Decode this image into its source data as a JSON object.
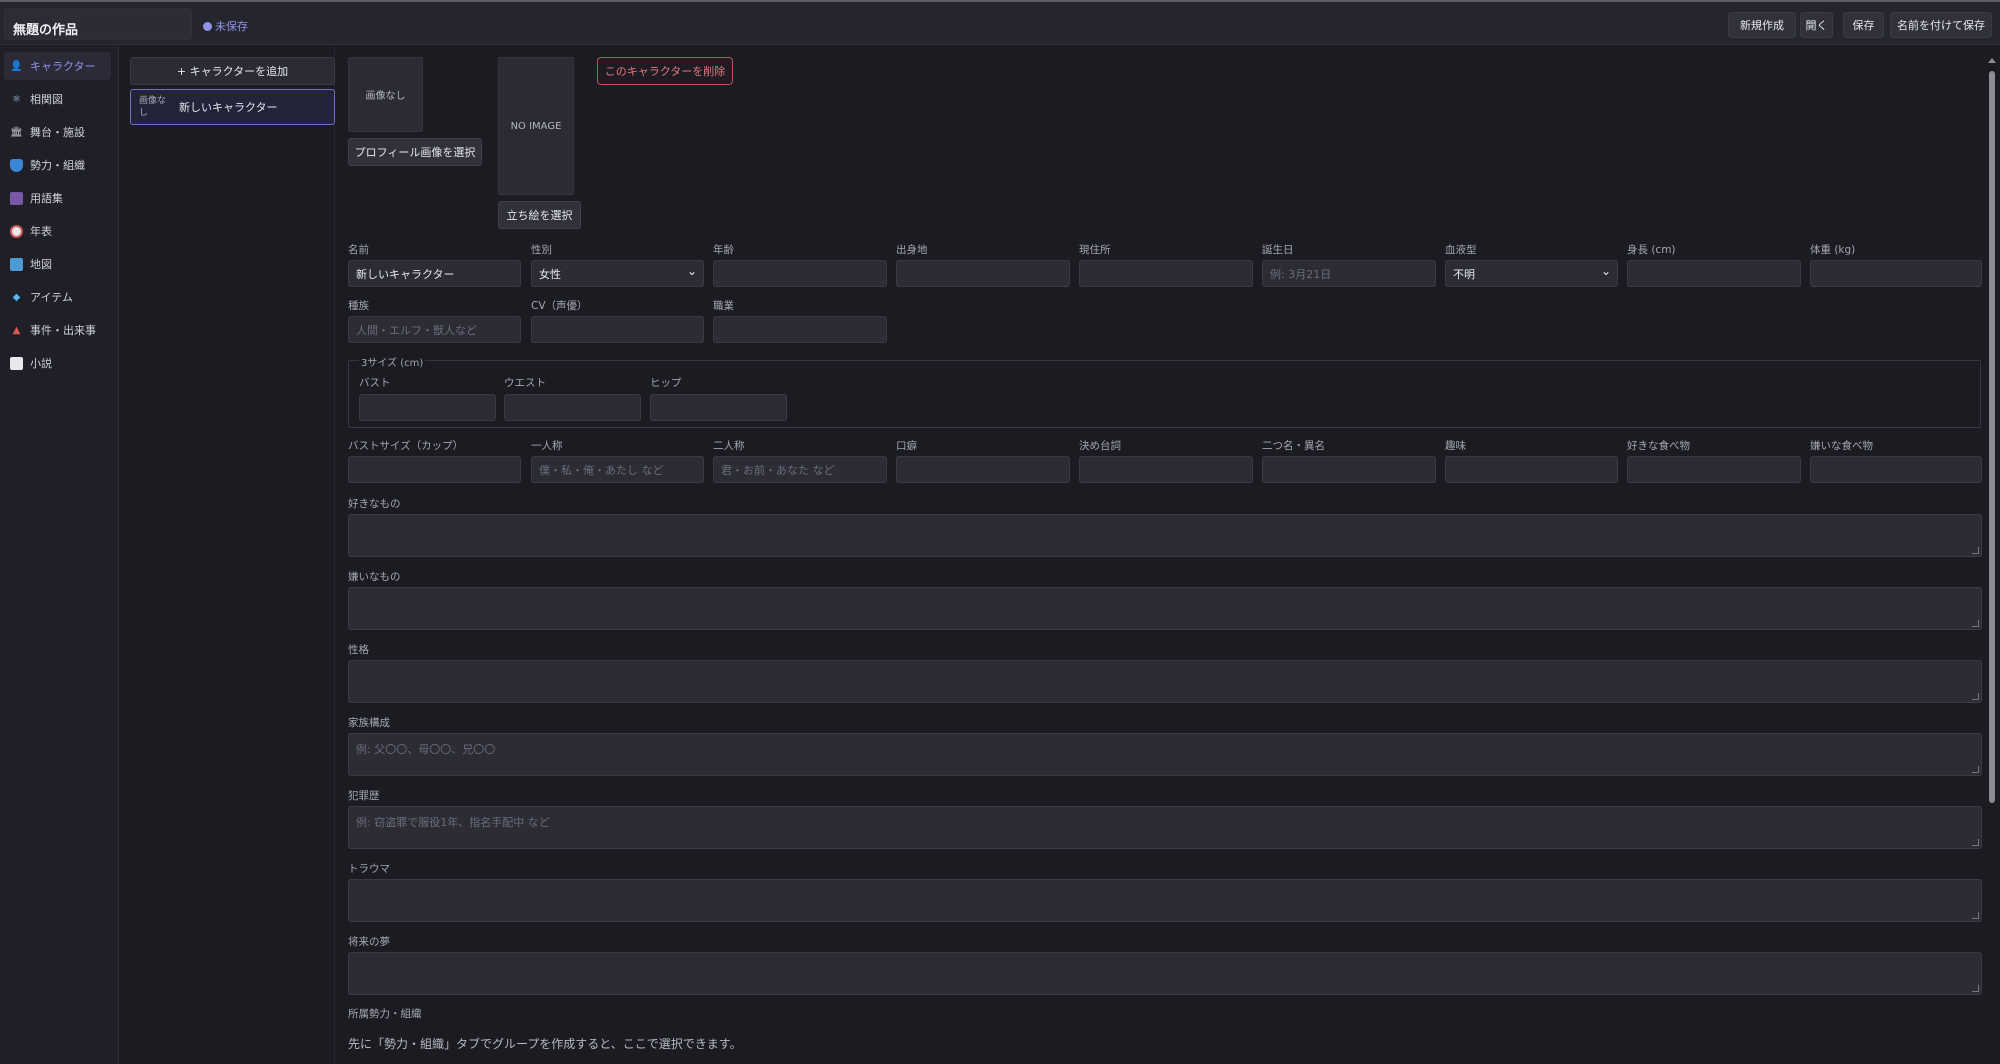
{
  "header": {
    "project_title": "無題の作品",
    "status": "未保存",
    "buttons": {
      "new": "新規作成",
      "open": "開く",
      "save": "保存",
      "save_as": "名前を付けて保存"
    }
  },
  "sidebar": {
    "items": [
      {
        "label": "キャラクター",
        "icon": "person-icon",
        "active": true
      },
      {
        "label": "相関図",
        "icon": "atom-icon"
      },
      {
        "label": "舞台・施設",
        "icon": "building-icon"
      },
      {
        "label": "勢力・組織",
        "icon": "shield-icon"
      },
      {
        "label": "用語集",
        "icon": "book-icon"
      },
      {
        "label": "年表",
        "icon": "clock-icon"
      },
      {
        "label": "地図",
        "icon": "map-icon"
      },
      {
        "label": "アイテム",
        "icon": "gem-icon"
      },
      {
        "label": "事件・出来事",
        "icon": "siren-icon"
      },
      {
        "label": "小説",
        "icon": "open-book-icon"
      }
    ]
  },
  "character_list": {
    "add_label": "+ キャラクターを追加",
    "items": [
      {
        "thumb": "画像なし",
        "name": "新しいキャラクター"
      }
    ]
  },
  "editor": {
    "profile_image": {
      "placeholder": "画像なし",
      "button": "プロフィール画像を選択"
    },
    "standing_image": {
      "placeholder": "NO IMAGE",
      "button": "立ち絵を選択"
    },
    "delete_label": "このキャラクターを削除",
    "row1": {
      "name": {
        "label": "名前",
        "value": "新しいキャラクター"
      },
      "gender": {
        "label": "性別",
        "value": "女性"
      },
      "age": {
        "label": "年齢",
        "value": ""
      },
      "birthplace": {
        "label": "出身地",
        "value": ""
      },
      "residence": {
        "label": "現住所",
        "value": ""
      },
      "birthday": {
        "label": "誕生日",
        "placeholder": "例: 3月21日"
      },
      "blood": {
        "label": "血液型",
        "value": "不明"
      },
      "height": {
        "label": "身長 (cm)",
        "value": ""
      },
      "weight": {
        "label": "体重 (kg)",
        "value": ""
      }
    },
    "row2": {
      "race": {
        "label": "種族",
        "placeholder": "人間・エルフ・獣人など"
      },
      "cv": {
        "label": "CV（声優）",
        "value": ""
      },
      "job": {
        "label": "職業",
        "value": ""
      }
    },
    "three_sizes": {
      "legend": "3サイズ (cm)",
      "bust": "バスト",
      "waist": "ウエスト",
      "hip": "ヒップ"
    },
    "row3": {
      "cup": {
        "label": "バストサイズ（カップ）",
        "value": ""
      },
      "first_person": {
        "label": "一人称",
        "placeholder": "僕・私・俺・あたし など"
      },
      "second_person": {
        "label": "二人称",
        "placeholder": "君・お前・あなた など"
      },
      "speech": {
        "label": "口癖",
        "value": ""
      },
      "catchphrase": {
        "label": "決め台詞",
        "value": ""
      },
      "alias": {
        "label": "二つ名・異名",
        "value": ""
      },
      "hobby": {
        "label": "趣味",
        "value": ""
      },
      "fav_food": {
        "label": "好きな食べ物",
        "value": ""
      },
      "dislike_food": {
        "label": "嫌いな食べ物",
        "value": ""
      }
    },
    "textareas": [
      {
        "label": "好きなもの",
        "placeholder": ""
      },
      {
        "label": "嫌いなもの",
        "placeholder": ""
      },
      {
        "label": "性格",
        "placeholder": ""
      },
      {
        "label": "家族構成",
        "placeholder": "例: 父〇〇、母〇〇、兄〇〇"
      },
      {
        "label": "犯罪歴",
        "placeholder": "例: 窃盗罪で服役1年、指名手配中 など"
      },
      {
        "label": "トラウマ",
        "placeholder": ""
      },
      {
        "label": "将来の夢",
        "placeholder": ""
      }
    ],
    "affiliation": {
      "label": "所属勢力・組織",
      "hint": "先に「勢力・組織」タブでグループを作成すると、ここで選択できます。"
    }
  },
  "colors": {
    "accent": "#8f93e8",
    "danger": "#e57982",
    "background": "#1b1c22"
  }
}
